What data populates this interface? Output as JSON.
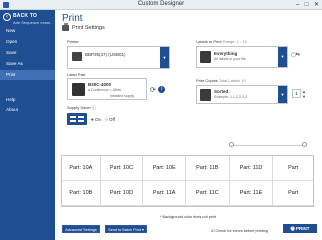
{
  "window": {
    "title": "Custom Designer",
    "controls": [
      "–",
      "□",
      "✕"
    ]
  },
  "sidebar": {
    "back_label": "BACK TO",
    "back_sub": "Ade Sequence exam...",
    "items": [
      {
        "label": "New"
      },
      {
        "label": "Open"
      },
      {
        "label": "Save"
      },
      {
        "label": "Save As"
      },
      {
        "label": "Print"
      },
      {
        "label": "Help"
      },
      {
        "label": "About"
      }
    ]
  },
  "page": {
    "title": "Print",
    "subtitle": "Print Settings"
  },
  "printer": {
    "label": "Printer",
    "value": "BBP35(37) (USB01)"
  },
  "label_part": {
    "label": "Label Part",
    "code": "B30C-4000",
    "opt1": "Continuous",
    "opt2": "Allow",
    "installed": "Installed supply"
  },
  "labels_to_print": {
    "label": "Labels to Print",
    "range": "Range: 1 - 10",
    "value": "Everything",
    "sub": "All labels in your file"
  },
  "print_copies": {
    "label": "Print Copies",
    "hint": "Total Labels 10",
    "value": "Sorted",
    "sub": "Example: 1,1,2,2,3,3",
    "count": "1"
  },
  "supply_saver": {
    "label": "Supply Saver",
    "info": "ⓘ",
    "on": "On",
    "off": "Off"
  },
  "tiles": [
    [
      "Part: 10A",
      "Part: 10C",
      "Part: 10E",
      "Part: 11B",
      "Part: 11D",
      "Part"
    ],
    [
      "Part: 10B",
      "Part: 10D",
      "Part: 11A",
      "Part: 11C",
      "Part: 11E",
      "Part"
    ]
  ],
  "note": "* Background color does not print",
  "buttons": {
    "advanced": "Advanced Settings",
    "batch": "Send to Batch Print ▾",
    "check_errors": "Check for errors before printing",
    "print": "PRINT"
  }
}
